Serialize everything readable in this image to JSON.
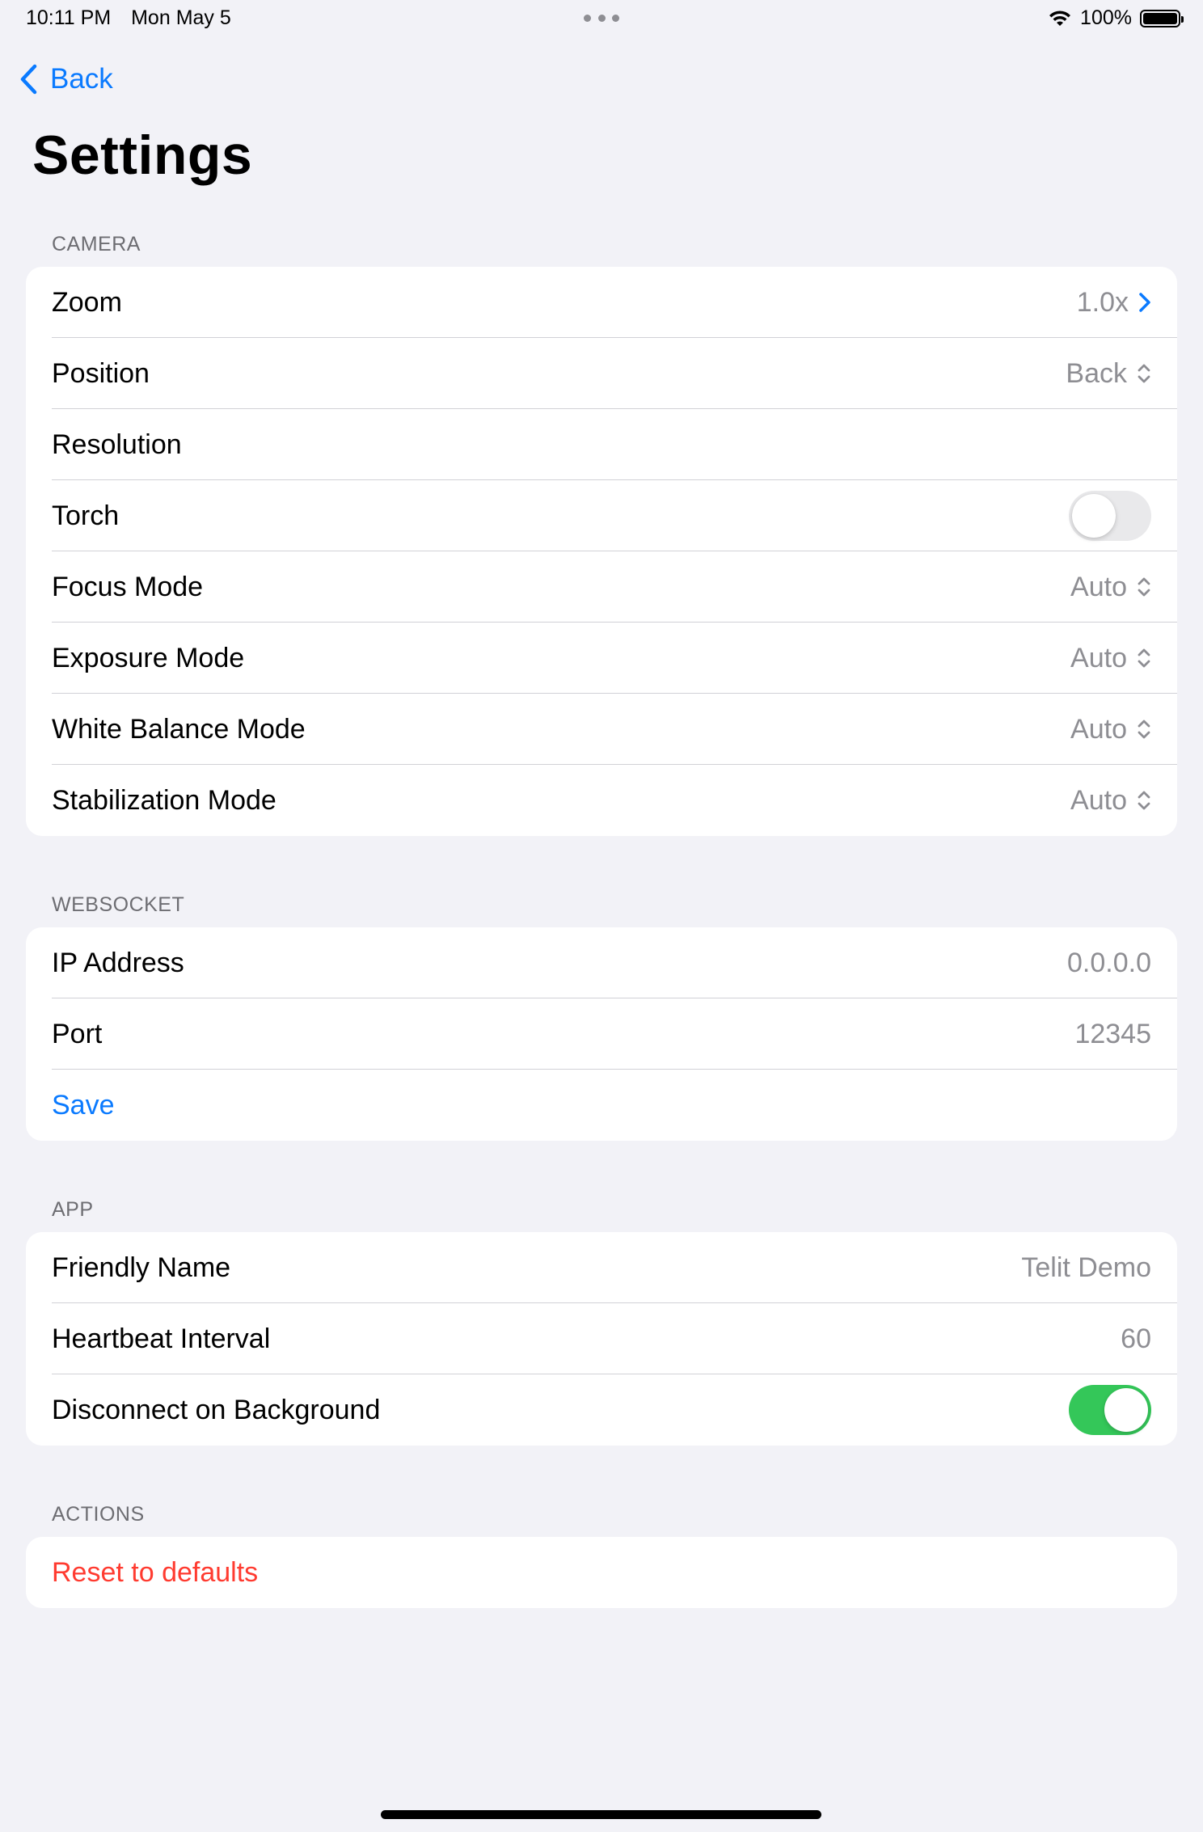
{
  "status_bar": {
    "time": "10:11 PM",
    "date": "Mon May 5",
    "battery": "100%"
  },
  "nav": {
    "back_label": "Back"
  },
  "title": "Settings",
  "camera": {
    "header": "CAMERA",
    "rows": {
      "zoom": {
        "label": "Zoom",
        "value": "1.0x"
      },
      "position": {
        "label": "Position",
        "value": "Back"
      },
      "resolution": {
        "label": "Resolution"
      },
      "torch": {
        "label": "Torch",
        "on": false
      },
      "focus": {
        "label": "Focus Mode",
        "value": "Auto"
      },
      "exposure": {
        "label": "Exposure Mode",
        "value": "Auto"
      },
      "white_balance": {
        "label": "White Balance Mode",
        "value": "Auto"
      },
      "stabilization": {
        "label": "Stabilization Mode",
        "value": "Auto"
      }
    }
  },
  "websocket": {
    "header": "WEBSOCKET",
    "ip": {
      "label": "IP Address",
      "placeholder": "0.0.0.0"
    },
    "port": {
      "label": "Port",
      "placeholder": "12345"
    },
    "save_label": "Save"
  },
  "app": {
    "header": "APP",
    "friendly_name": {
      "label": "Friendly Name",
      "value": "Telit Demo"
    },
    "heartbeat": {
      "label": "Heartbeat Interval",
      "value": "60"
    },
    "disconnect": {
      "label": "Disconnect on Background",
      "on": true
    }
  },
  "actions": {
    "header": "ACTIONS",
    "reset_label": "Reset to defaults"
  },
  "colors": {
    "accent": "#0a7aff",
    "destructive": "#ff3b30",
    "toggle_on": "#34c759",
    "background": "#f2f2f7"
  }
}
